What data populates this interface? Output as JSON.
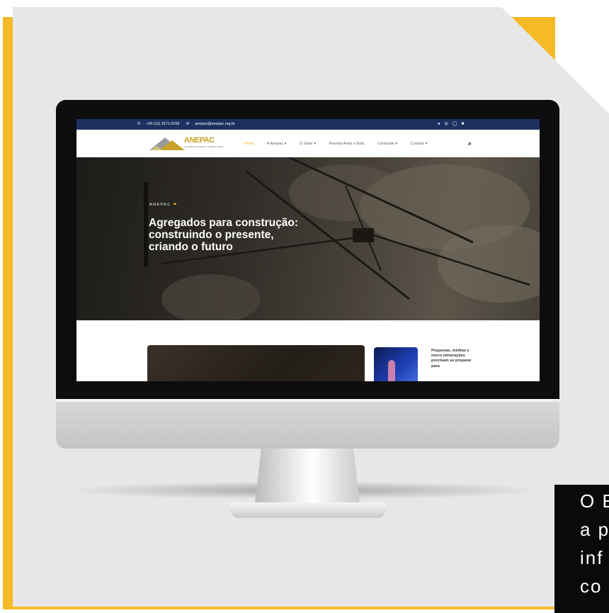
{
  "topbar": {
    "phone": "+55 (11) 3171.0159",
    "email": "anepac@anepac.org.br",
    "socials": [
      "facebook-icon",
      "instagram-icon",
      "whatsapp-icon",
      "linkedin-icon"
    ]
  },
  "logo": {
    "word": "ANEPAC",
    "tagline": "Construindo o Presente, Criando o Futuro"
  },
  "nav": {
    "items": [
      "Home",
      "A Anepac ▾",
      "O Setor ▾",
      "Revista Areia e Brita",
      "Conteúdo ▾",
      "Contato ▾"
    ],
    "active_index": 0
  },
  "hero": {
    "eyebrow": "ANEPAC",
    "title": "Agregados para construção: construindo o presente, criando o futuro"
  },
  "content": {
    "side_post_title": "Pequenas, médias e micro minerações precisam se preparar para"
  },
  "caption": {
    "lines": [
      "O E",
      "a p",
      "inf",
      "co"
    ]
  },
  "colors": {
    "accent": "#f6b927",
    "topbar": "#1c3160",
    "panel": "#e7e7e7"
  }
}
